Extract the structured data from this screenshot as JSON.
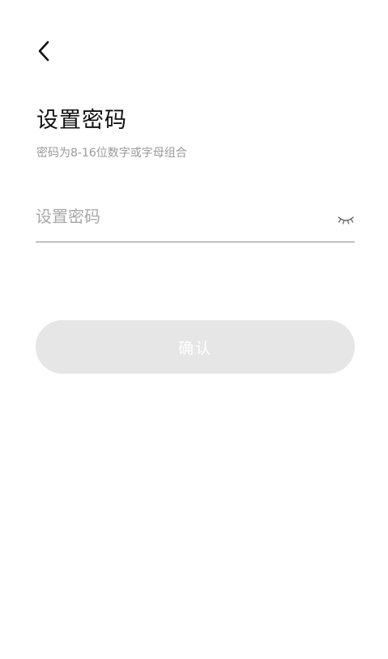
{
  "nav": {
    "back_icon": "chevron-left-icon"
  },
  "header": {
    "title": "设置密码",
    "subtitle": "密码为8-16位数字或字母组合"
  },
  "form": {
    "password_placeholder": "设置密码",
    "password_value": "",
    "visibility_icon": "eye-closed-icon"
  },
  "actions": {
    "confirm_label": "确认"
  },
  "colors": {
    "button_disabled_bg": "#e6e6e6",
    "title_text": "#111111",
    "hint_text": "#9a9a9a",
    "divider": "#8a8a8a"
  }
}
